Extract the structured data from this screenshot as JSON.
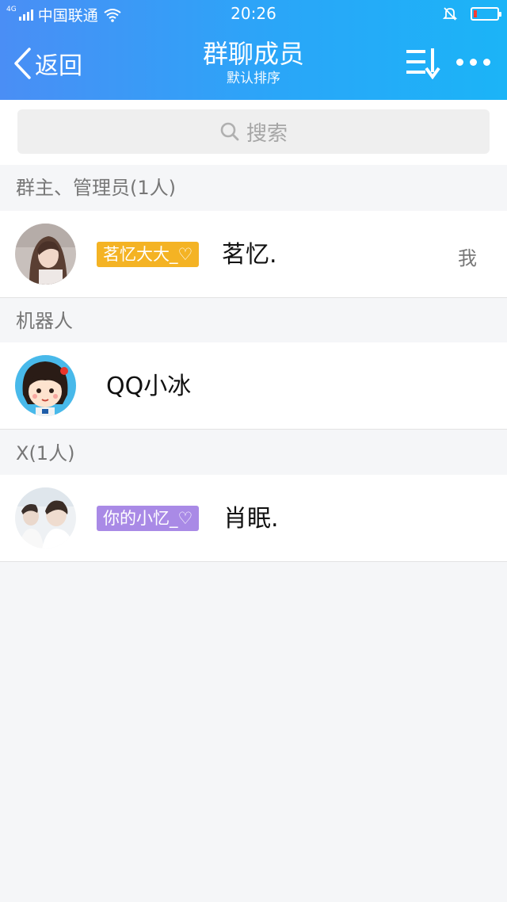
{
  "status_bar": {
    "network": "4G",
    "carrier": "中国联通",
    "time": "20:26",
    "battery_level": 0.1
  },
  "nav": {
    "back_label": "返回",
    "title": "群聊成员",
    "subtitle": "默认排序",
    "icons": [
      "chevron-left-icon",
      "sort-icon",
      "more-icon"
    ]
  },
  "search": {
    "placeholder": "搜索"
  },
  "sections": [
    {
      "title": "群主、管理员(1人)",
      "members": [
        {
          "tag": "茗忆大大_♡",
          "tag_color": "#f4b324",
          "name": "茗忆.",
          "badge": "我"
        }
      ]
    },
    {
      "title": "机器人",
      "members": [
        {
          "name": "QQ小冰"
        }
      ]
    },
    {
      "title": "X(1人)",
      "members": [
        {
          "tag": "你的小忆_♡",
          "tag_color": "#a98ae6",
          "name": "肖眠."
        }
      ]
    }
  ],
  "colors": {
    "header_start": "#4a8ef5",
    "header_end": "#1bb4f7",
    "background": "#f5f6f8"
  }
}
